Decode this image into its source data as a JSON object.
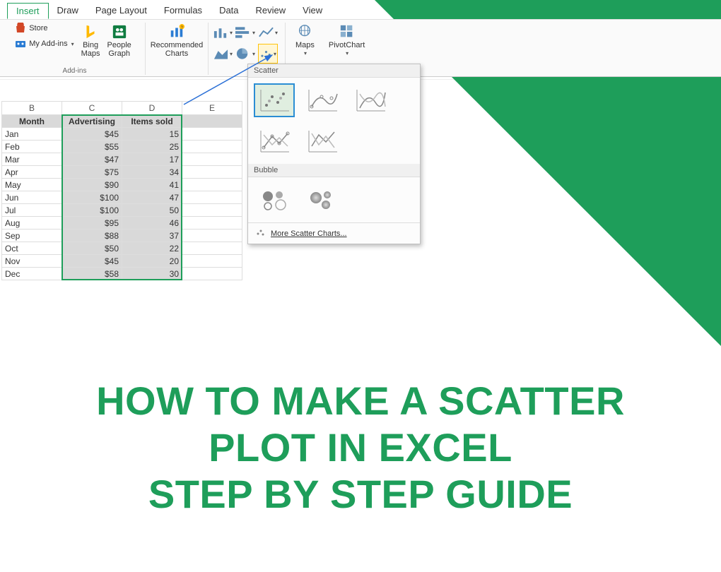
{
  "ribbon": {
    "tabs": [
      "Insert",
      "Draw",
      "Page Layout",
      "Formulas",
      "Data",
      "Review",
      "View"
    ],
    "active_tab_index": 0,
    "store_label": "Store",
    "my_addins_label": "My Add-ins",
    "bing_maps_label": "Bing\nMaps",
    "people_graph_label": "People\nGraph",
    "addins_group_label": "Add-ins",
    "recommended_charts_label": "Recommended\nCharts",
    "maps_label": "Maps",
    "pivotchart_label": "PivotChart"
  },
  "scatter_panel": {
    "section1": "Scatter",
    "section2": "Bubble",
    "more_label": "More Scatter Charts..."
  },
  "sheet": {
    "columns": [
      "B",
      "C",
      "D",
      "E"
    ],
    "headers": {
      "B": "Month",
      "C": "Advertising",
      "D": "Items sold"
    },
    "rows": [
      {
        "month": "Jan",
        "adv": "$45",
        "sold": "15"
      },
      {
        "month": "Feb",
        "adv": "$55",
        "sold": "25"
      },
      {
        "month": "Mar",
        "adv": "$47",
        "sold": "17"
      },
      {
        "month": "Apr",
        "adv": "$75",
        "sold": "34"
      },
      {
        "month": "May",
        "adv": "$90",
        "sold": "41"
      },
      {
        "month": "Jun",
        "adv": "$100",
        "sold": "47"
      },
      {
        "month": "Jul",
        "adv": "$100",
        "sold": "50"
      },
      {
        "month": "Aug",
        "adv": "$95",
        "sold": "46"
      },
      {
        "month": "Sep",
        "adv": "$88",
        "sold": "37"
      },
      {
        "month": "Oct",
        "adv": "$50",
        "sold": "22"
      },
      {
        "month": "Nov",
        "adv": "$45",
        "sold": "20"
      },
      {
        "month": "Dec",
        "adv": "$58",
        "sold": "30"
      }
    ]
  },
  "title": {
    "line1": "HOW TO MAKE A SCATTER",
    "line2": "PLOT IN EXCEL",
    "line3": "STEP BY STEP GUIDE"
  },
  "colors": {
    "brand_green": "#1e9e5a",
    "hover_blue": "#2a8dd4"
  }
}
